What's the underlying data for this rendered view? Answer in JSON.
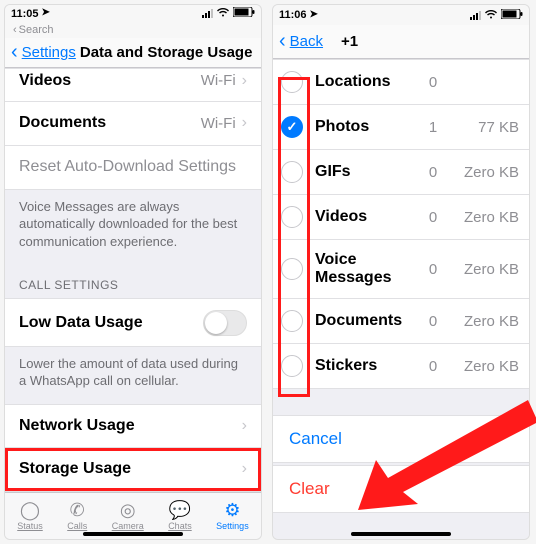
{
  "left": {
    "status": {
      "time": "11:05",
      "loc_glyph": "➤",
      "search_crumb": "Search"
    },
    "nav": {
      "back": "Settings",
      "title": "Data and Storage Usage"
    },
    "rows": {
      "videos": {
        "label": "Videos",
        "value": "Wi-Fi"
      },
      "documents": {
        "label": "Documents",
        "value": "Wi-Fi"
      },
      "reset": "Reset Auto-Download Settings"
    },
    "note_voice": "Voice Messages are always automatically downloaded for the best communication experience.",
    "call_header": "CALL SETTINGS",
    "low_data": "Low Data Usage",
    "note_call": "Lower the amount of data used during a WhatsApp call on cellular.",
    "network_usage": "Network Usage",
    "storage_usage": "Storage Usage",
    "tabs": {
      "status": "Status",
      "calls": "Calls",
      "camera": "Camera",
      "chats": "Chats",
      "settings": "Settings"
    }
  },
  "right": {
    "status": {
      "time": "11:06",
      "loc_glyph": "➤"
    },
    "nav": {
      "back": "Back",
      "title": "+1"
    },
    "items": [
      {
        "label": "Locations",
        "count": "0",
        "size": "",
        "checked": false
      },
      {
        "label": "Photos",
        "count": "1",
        "size": "77 KB",
        "checked": true
      },
      {
        "label": "GIFs",
        "count": "0",
        "size": "Zero KB",
        "checked": false
      },
      {
        "label": "Videos",
        "count": "0",
        "size": "Zero KB",
        "checked": false
      },
      {
        "label": "Voice Messages",
        "count": "0",
        "size": "Zero KB",
        "checked": false
      },
      {
        "label": "Documents",
        "count": "0",
        "size": "Zero KB",
        "checked": false
      },
      {
        "label": "Stickers",
        "count": "0",
        "size": "Zero KB",
        "checked": false
      }
    ],
    "actions": {
      "cancel": "Cancel",
      "clear": "Clear"
    }
  }
}
